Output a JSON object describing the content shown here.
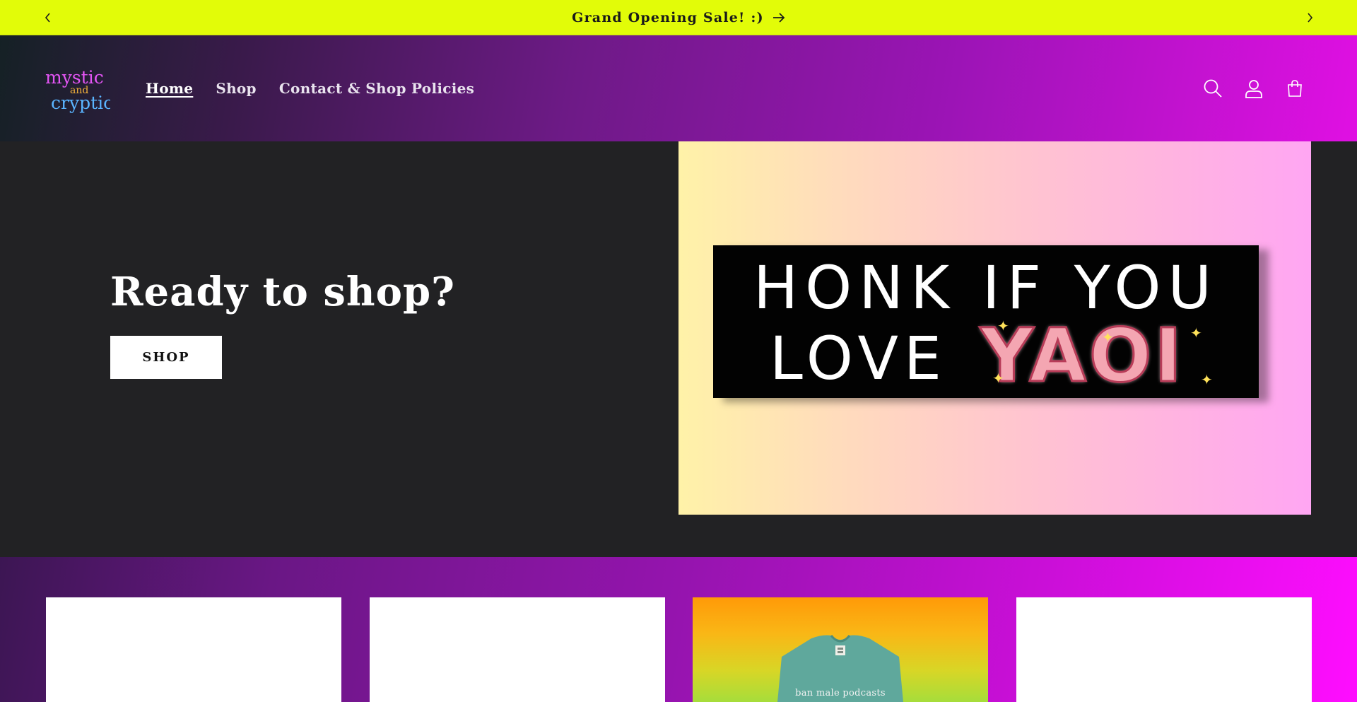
{
  "announcement": {
    "message": "Grand Opening Sale! :)",
    "background": "#e2fc08"
  },
  "header": {
    "logo_text": [
      "mystic",
      "and",
      "cryptic"
    ],
    "nav": [
      {
        "label": "Home",
        "active": true
      },
      {
        "label": "Shop",
        "active": false
      },
      {
        "label": "Contact & Shop Policies",
        "active": false
      }
    ],
    "icons": [
      "search-icon",
      "account-icon",
      "cart-icon"
    ]
  },
  "hero": {
    "title": "Ready to shop?",
    "button_label": "SHOP",
    "sticker": {
      "line1": "HONK IF YOU",
      "line2": "LOVE",
      "highlight": "YAOI"
    }
  },
  "collection": {
    "cards": [
      {
        "image": "blank"
      },
      {
        "image": "blank"
      },
      {
        "image": "tshirt",
        "shirt_text": "ban male podcasts"
      },
      {
        "image": "blank"
      }
    ]
  },
  "colors": {
    "accent_magenta": "#e010e3",
    "hero_background": "#222224",
    "sticker_pink": "#f4a6b2"
  }
}
